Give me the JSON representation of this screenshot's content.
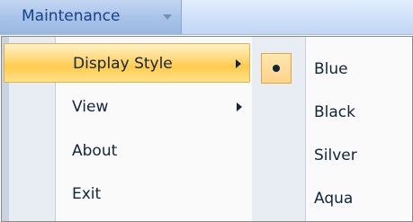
{
  "menubar": {
    "menu_label": "Maintenance",
    "caret_icon": "chevron-down-icon"
  },
  "main_menu": {
    "items": [
      {
        "label": "Display Style",
        "has_submenu": true,
        "highlighted": true
      },
      {
        "label": "View",
        "has_submenu": true,
        "highlighted": false
      },
      {
        "label": "About",
        "has_submenu": false,
        "highlighted": false
      },
      {
        "label": "Exit",
        "has_submenu": false,
        "highlighted": false
      }
    ]
  },
  "display_style_submenu": {
    "items": [
      {
        "label": "Blue",
        "selected": true
      },
      {
        "label": "Black",
        "selected": false
      },
      {
        "label": "Silver",
        "selected": false
      },
      {
        "label": "Aqua",
        "selected": false
      }
    ]
  },
  "colors": {
    "highlight": "#ffd97a",
    "menubar": "#c4d7f2",
    "text": "#10253f"
  }
}
